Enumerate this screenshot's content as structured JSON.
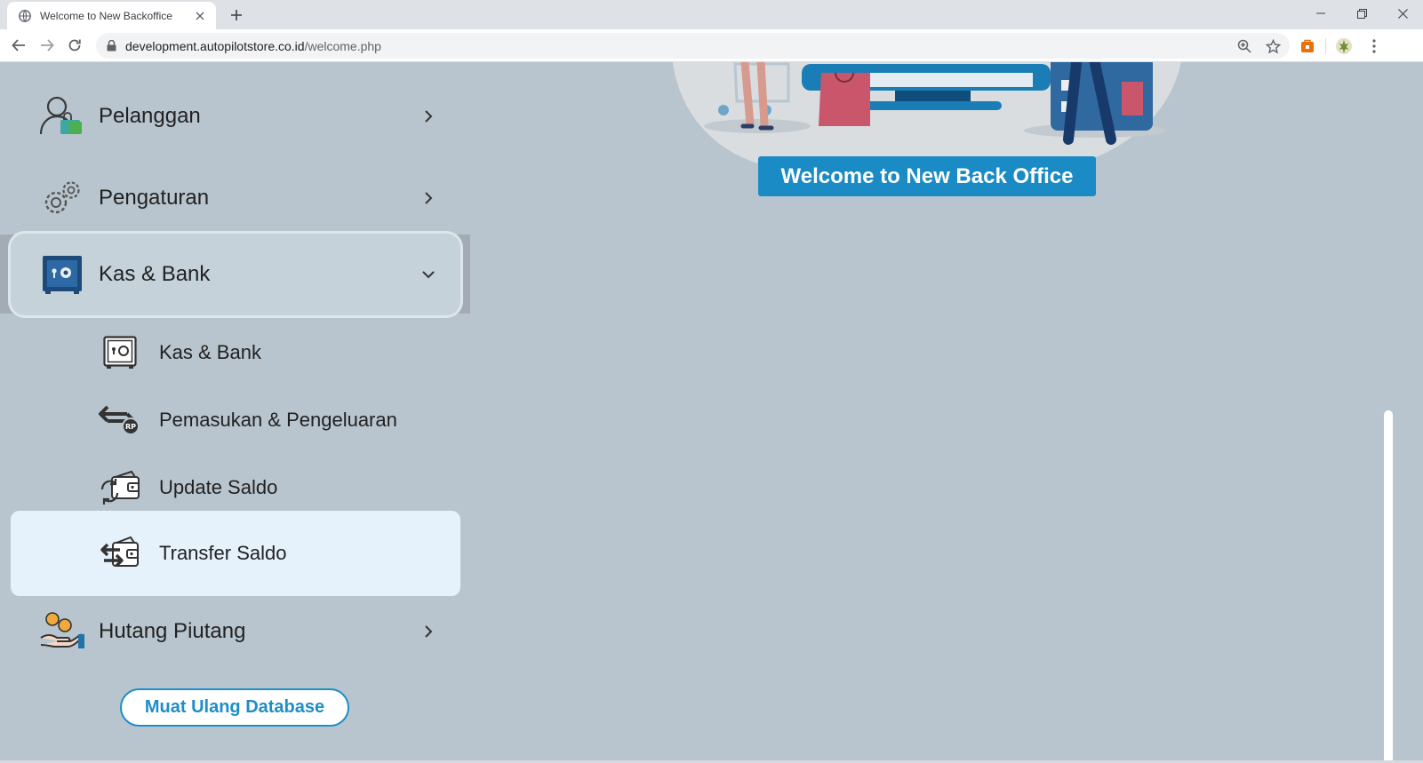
{
  "browser": {
    "tab_title": "Welcome to New Backoffice",
    "url_host": "development.autopilotstore.co.id",
    "url_path": "/welcome.php"
  },
  "sidebar": {
    "items": [
      {
        "label": "Pelanggan",
        "icon": "customer-icon"
      },
      {
        "label": "Pengaturan",
        "icon": "gears-icon"
      },
      {
        "label": "Kas & Bank",
        "icon": "safe-icon"
      },
      {
        "label": "Hutang Piutang",
        "icon": "coins-hand-icon"
      }
    ],
    "submenu": [
      {
        "label": "Kas & Bank",
        "icon": "safe-outline-icon"
      },
      {
        "label": "Pemasukan & Pengeluaran",
        "icon": "exchange-rp-icon"
      },
      {
        "label": "Update Saldo",
        "icon": "wallet-refresh-icon"
      },
      {
        "label": "Transfer Saldo",
        "icon": "wallet-transfer-icon"
      }
    ],
    "reload_button": "Muat Ulang Database"
  },
  "main": {
    "welcome_text": "Welcome to New Back Office"
  },
  "colors": {
    "page_bg": "#b9c5ce",
    "accent": "#1a8bc4",
    "selected_bg": "#e5f2fb"
  }
}
